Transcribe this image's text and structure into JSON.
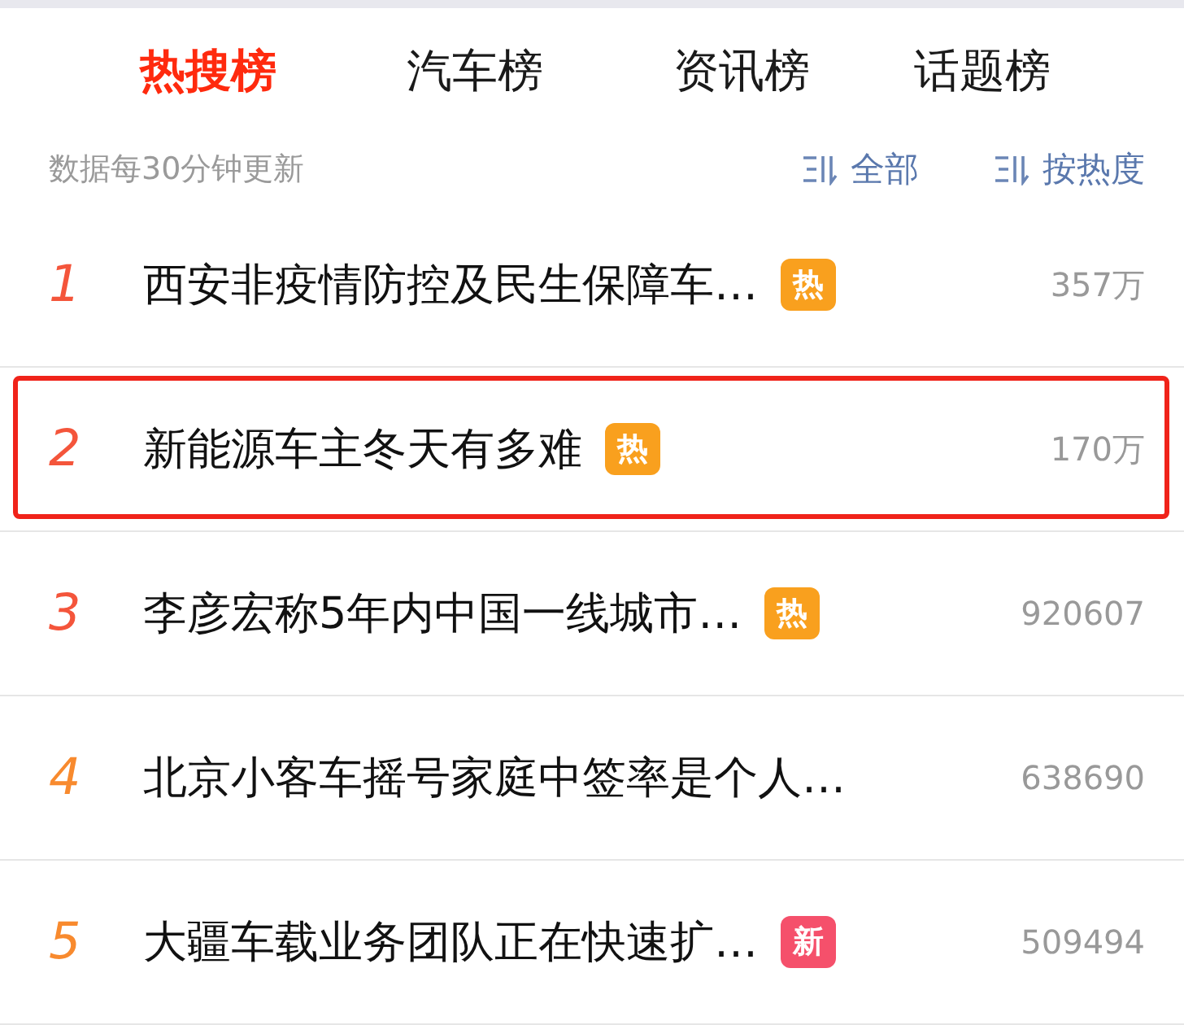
{
  "tabs": [
    {
      "label": "热搜榜",
      "selected": true
    },
    {
      "label": "汽车榜",
      "selected": false
    },
    {
      "label": "资讯榜",
      "selected": false
    },
    {
      "label": "话题榜",
      "selected": false
    }
  ],
  "update_note": "数据每30分钟更新",
  "filters": [
    {
      "label": "全部"
    },
    {
      "label": "按热度"
    }
  ],
  "rows": [
    {
      "rank": "1",
      "color": "#f4553b",
      "title": "西安非疫情防控及民生保障车…",
      "badge": {
        "kind": "hot",
        "text": "热"
      },
      "count": "357万",
      "selected": false
    },
    {
      "rank": "2",
      "color": "#f4553b",
      "title": "新能源车主冬天有多难",
      "badge": {
        "kind": "hot",
        "text": "热"
      },
      "count": "170万",
      "selected": true
    },
    {
      "rank": "3",
      "color": "#f4553b",
      "title": "李彦宏称5年内中国一线城市…",
      "badge": {
        "kind": "hot",
        "text": "热"
      },
      "count": "920607",
      "selected": false
    },
    {
      "rank": "4",
      "color": "#f88a2e",
      "title": "北京小客车摇号家庭中签率是个人…",
      "count": "638690",
      "selected": false
    },
    {
      "rank": "5",
      "color": "#f88a2e",
      "title": "大疆车载业务团队正在快速扩…",
      "badge": {
        "kind": "new",
        "text": "新"
      },
      "count": "509494",
      "selected": false
    }
  ]
}
